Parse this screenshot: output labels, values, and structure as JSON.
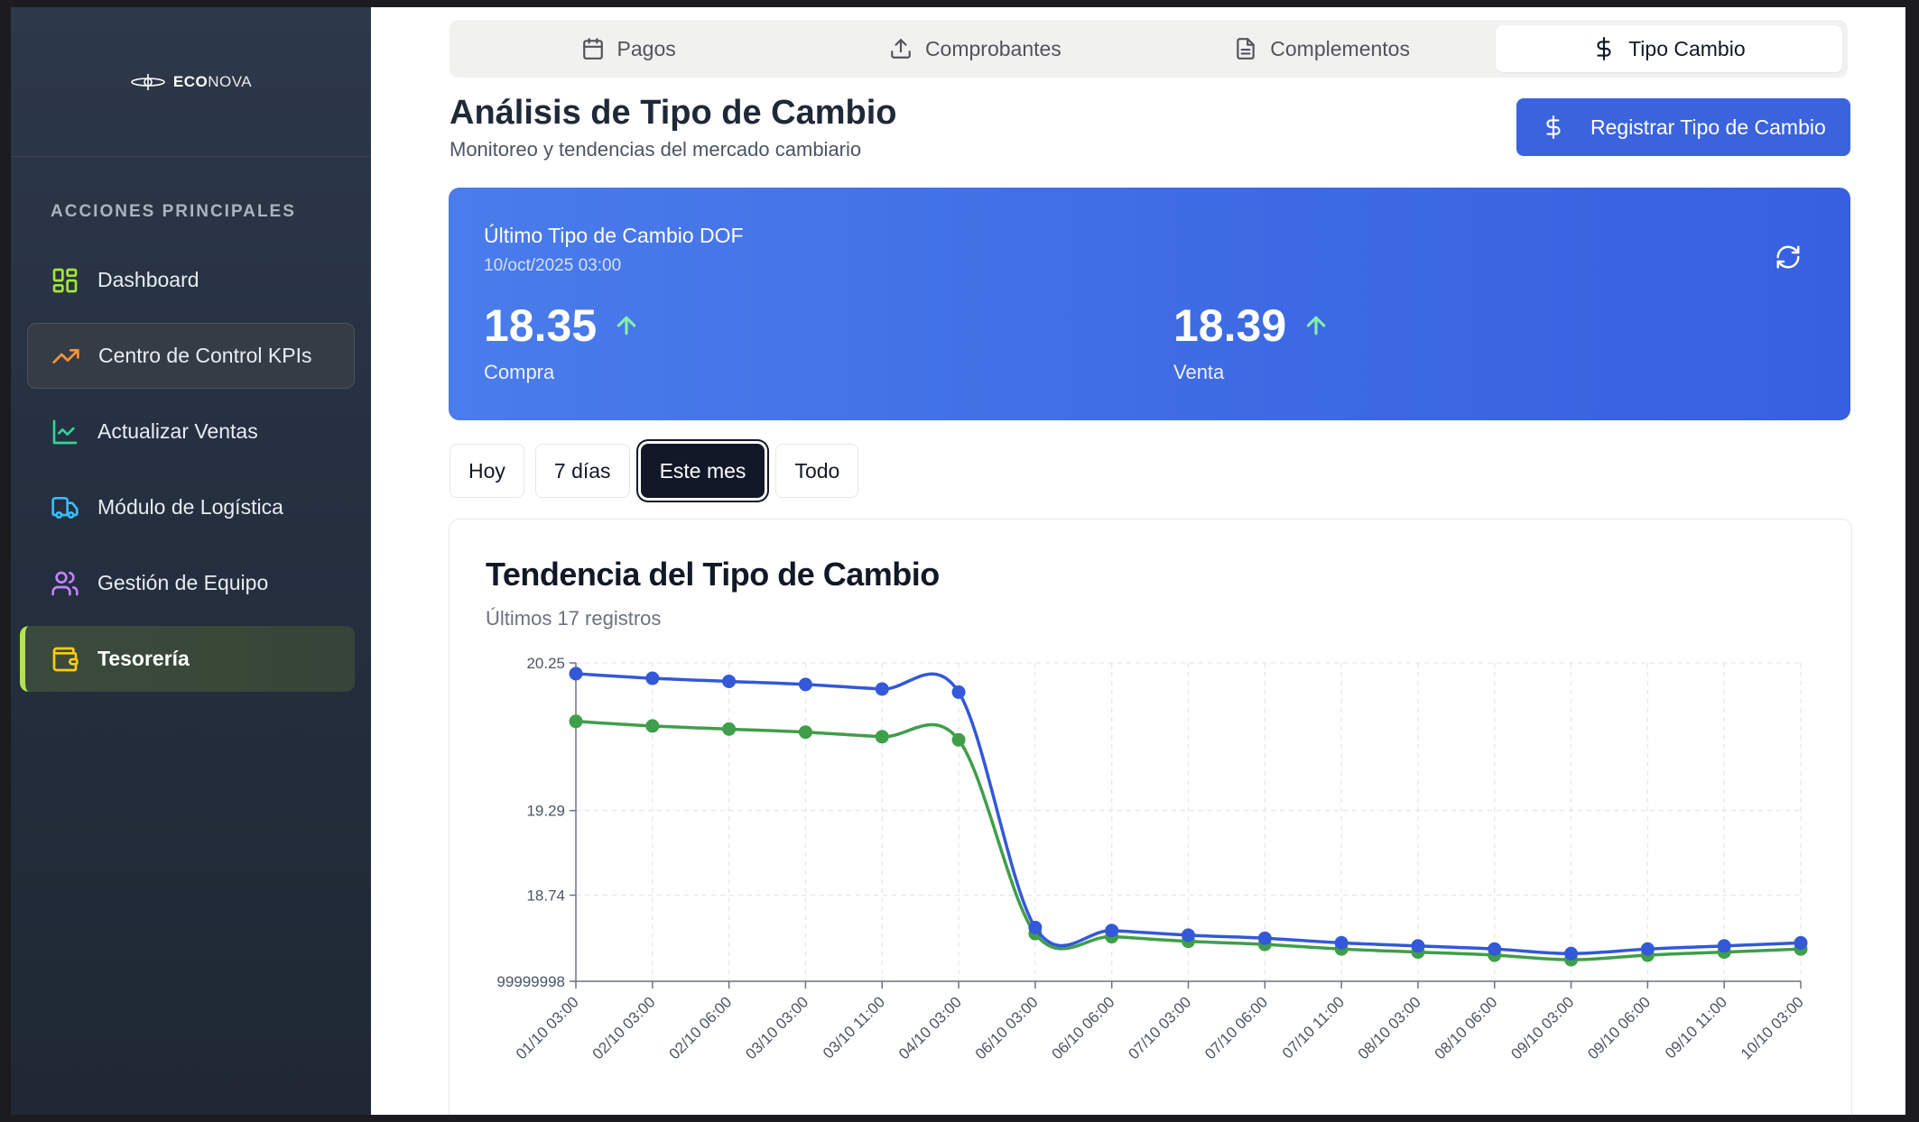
{
  "brand": {
    "name_bold": "ECO",
    "name_rest": "NOVA",
    "logo_icon": "orbit-logo-icon"
  },
  "sidebar": {
    "section_title": "ACCIONES PRINCIPALES",
    "items": [
      {
        "label": "Dashboard",
        "icon": "grid-icon",
        "icon_color": "#a3e635"
      },
      {
        "label": "Centro de Control KPIs",
        "icon": "trending-up-icon",
        "icon_color": "#fb923c"
      },
      {
        "label": "Actualizar Ventas",
        "icon": "line-chart-icon",
        "icon_color": "#34d399"
      },
      {
        "label": "Módulo de Logística",
        "icon": "truck-icon",
        "icon_color": "#38bdf8"
      },
      {
        "label": "Gestión de Equipo",
        "icon": "users-icon",
        "icon_color": "#c084fc"
      },
      {
        "label": "Tesorería",
        "icon": "wallet-icon",
        "icon_color": "#facc15"
      }
    ],
    "active_index": 5
  },
  "tabs": [
    {
      "label": "Pagos",
      "icon": "calendar-icon"
    },
    {
      "label": "Comprobantes",
      "icon": "upload-icon"
    },
    {
      "label": "Complementos",
      "icon": "document-icon"
    },
    {
      "label": "Tipo Cambio",
      "icon": "dollar-icon"
    }
  ],
  "active_tab": 3,
  "header": {
    "title": "Análisis de Tipo de Cambio",
    "subtitle": "Monitoreo y tendencias del mercado cambiario",
    "register_button": "Registrar Tipo de Cambio"
  },
  "rate_card": {
    "label": "Último Tipo de Cambio DOF",
    "date": "10/oct/2025 03:00",
    "buy_value": "18.35",
    "buy_label": "Compra",
    "sell_value": "18.39",
    "sell_label": "Venta",
    "trend": "up"
  },
  "filters": [
    "Hoy",
    "7 días",
    "Este mes",
    "Todo"
  ],
  "active_filter": 2,
  "chart": {
    "title": "Tendencia del Tipo de Cambio",
    "subtitle": "Últimos 17 registros"
  },
  "chart_data": {
    "type": "line",
    "categories": [
      "01/10 03:00",
      "02/10 03:00",
      "02/10 06:00",
      "03/10 03:00",
      "03/10 11:00",
      "04/10 03:00",
      "06/10 03:00",
      "06/10 06:00",
      "07/10 03:00",
      "07/10 06:00",
      "07/10 11:00",
      "08/10 03:00",
      "08/10 06:00",
      "09/10 03:00",
      "09/10 06:00",
      "09/10 11:00",
      "10/10 03:00"
    ],
    "series": [
      {
        "color": "#3358d8",
        "values": [
          20.18,
          20.15,
          20.13,
          20.11,
          20.08,
          20.06,
          18.53,
          18.51,
          18.48,
          18.46,
          18.43,
          18.41,
          18.39,
          18.36,
          18.39,
          18.41,
          18.43
        ]
      },
      {
        "color": "#3f9e4a",
        "values": [
          19.87,
          19.84,
          19.82,
          19.8,
          19.77,
          19.75,
          18.49,
          18.47,
          18.44,
          18.42,
          18.39,
          18.37,
          18.35,
          18.32,
          18.35,
          18.37,
          18.39
        ]
      }
    ],
    "y_ticks": [
      "20.25",
      "19.29",
      "18.74",
      "99999998"
    ],
    "y_tick_values": [
      20.25,
      19.29,
      18.74,
      18.18
    ],
    "ylim": [
      18.18,
      20.25
    ],
    "grid": true
  }
}
